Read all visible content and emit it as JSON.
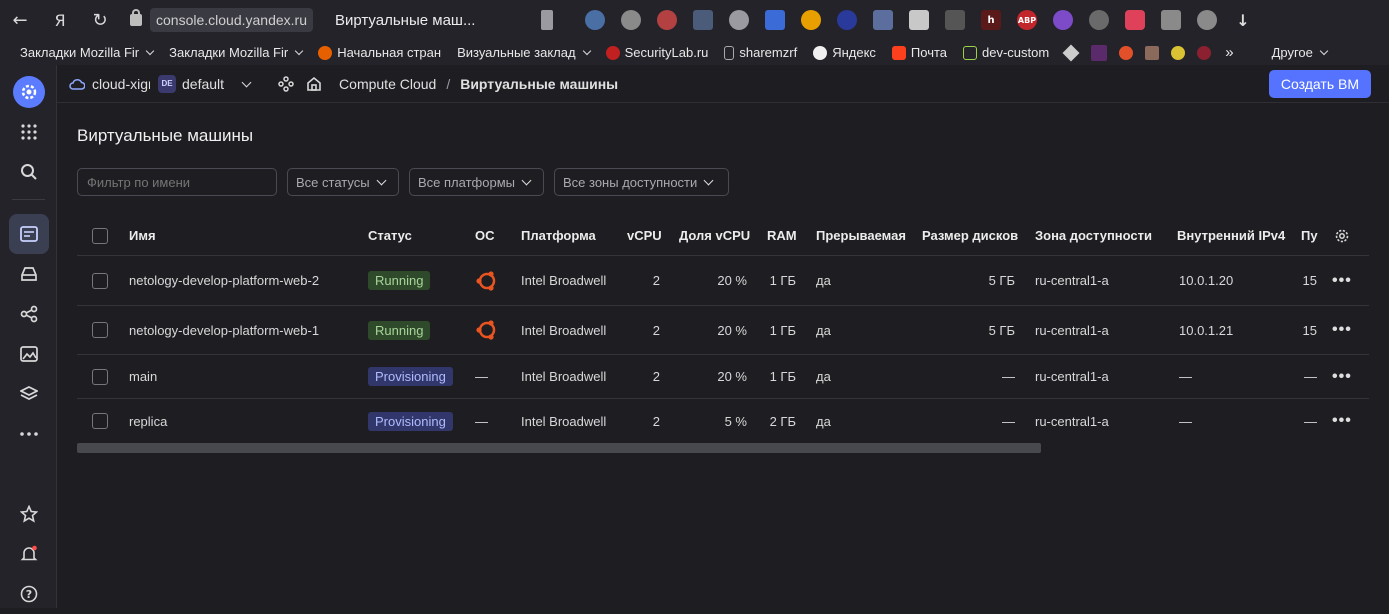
{
  "browser": {
    "url": "console.cloud.yandex.ru",
    "tab_title": "Виртуальные маш..."
  },
  "bookmarks": [
    {
      "label": "Закладки Mozilla Fir",
      "chevron": true
    },
    {
      "label": "Закладки Mozilla Fir",
      "chevron": true
    },
    {
      "label": "Начальная стран",
      "chevron": false
    },
    {
      "label": "Визуальные заклад",
      "chevron": true
    },
    {
      "label": "SecurityLab.ru",
      "chevron": false
    },
    {
      "label": "sharemzrf",
      "chevron": false
    },
    {
      "label": "Яндекс",
      "chevron": false
    },
    {
      "label": "Почта",
      "chevron": false
    },
    {
      "label": "dev-custom",
      "chevron": false
    }
  ],
  "bookmarks_other": "Другое",
  "header": {
    "cloud": "cloud-xigr",
    "folder_badge": "DE",
    "folder": "default",
    "breadcrumb_service": "Compute Cloud",
    "breadcrumb_sep": "/",
    "breadcrumb_current": "Виртуальные машины",
    "create_button": "Создать ВМ"
  },
  "page": {
    "title": "Виртуальные машины",
    "filter_placeholder": "Фильтр по имени",
    "status_select": "Все статусы",
    "platform_select": "Все платформы",
    "zone_select": "Все зоны доступности"
  },
  "table": {
    "columns": {
      "name": "Имя",
      "status": "Статус",
      "os": "ОС",
      "platform": "Платформа",
      "vcpu": "vCPU",
      "vcpu_share": "Доля vCPU",
      "ram": "RAM",
      "preemptible": "Прерываемая",
      "disk": "Размер дисков",
      "zone": "Зона доступности",
      "ipv4": "Внутренний IPv4",
      "public": "Пу"
    },
    "rows": [
      {
        "name": "netology-develop-platform-web-2",
        "status": "Running",
        "os": "ubuntu-icon",
        "platform": "Intel Broadwell",
        "vcpu": "2",
        "vcpu_share": "20 %",
        "ram": "1 ГБ",
        "preemptible": "да",
        "disk": "5 ГБ",
        "zone": "ru-central1-a",
        "ipv4": "10.0.1.20",
        "public": "15"
      },
      {
        "name": "netology-develop-platform-web-1",
        "status": "Running",
        "os": "ubuntu-icon",
        "platform": "Intel Broadwell",
        "vcpu": "2",
        "vcpu_share": "20 %",
        "ram": "1 ГБ",
        "preemptible": "да",
        "disk": "5 ГБ",
        "zone": "ru-central1-a",
        "ipv4": "10.0.1.21",
        "public": "15"
      },
      {
        "name": "main",
        "status": "Provisioning",
        "os": "—",
        "platform": "Intel Broadwell",
        "vcpu": "2",
        "vcpu_share": "20 %",
        "ram": "1 ГБ",
        "preemptible": "да",
        "disk": "—",
        "zone": "ru-central1-a",
        "ipv4": "—",
        "public": "—"
      },
      {
        "name": "replica",
        "status": "Provisioning",
        "os": "—",
        "platform": "Intel Broadwell",
        "vcpu": "2",
        "vcpu_share": "5 %",
        "ram": "2 ГБ",
        "preemptible": "да",
        "disk": "—",
        "zone": "ru-central1-a",
        "ipv4": "—",
        "public": "—"
      }
    ],
    "row_menu": "•••"
  },
  "colors": {
    "accent": "#5573ff",
    "running": "#a8d49a",
    "provisioning": "#b0bbff",
    "ubuntu": "#e95420"
  }
}
